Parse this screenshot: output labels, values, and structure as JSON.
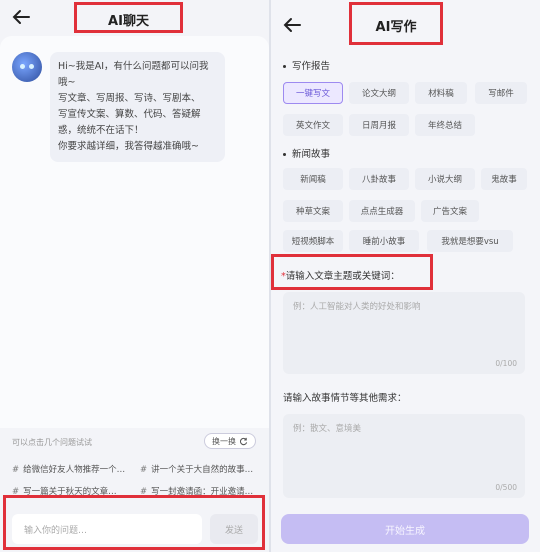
{
  "left": {
    "title": "AI聊天",
    "message_lines": [
      "Hi~我是AI，有什么问题都可以问我哦~",
      "写文章、写周报、写诗、写剧本、",
      "写宣传文案、算数、代码、答疑解",
      "惑，统统不在话下！",
      "你要求越详细，我答得越准确哦~"
    ],
    "hint": "可以点击几个问题试试",
    "swap_label": "换一换",
    "suggestions": [
      "给微信好友人物推荐一个…",
      "讲一个关于大自然的故事…",
      "写一篇关于秋天的文章…",
      "写一封邀请函：开业邀请…"
    ],
    "input_placeholder": "输入你的问题…",
    "send_label": "发送"
  },
  "right": {
    "title": "AI写作",
    "section1": "写作报告",
    "section1_chips": [
      "一键写文",
      "论文大纲",
      "材料稿",
      "写邮件",
      "英文作文",
      "日周月报",
      "年终总结"
    ],
    "section2": "新闻故事",
    "section2_chips": [
      "新闻稿",
      "八卦故事",
      "小说大纲",
      "鬼故事",
      "种草文案",
      "点点生成器",
      "广告文案",
      "短视频脚本",
      "睡前小故事",
      "我就是想要vsu"
    ],
    "field1_label": "请输入文章主题或关键词：",
    "field1_placeholder": "例：人工智能对人类的好处和影响",
    "field1_count": "0/100",
    "field2_label": "请输入故事情节等其他需求：",
    "field2_placeholder": "例：散文、意境美",
    "field2_count": "0/500",
    "generate_label": "开始生成"
  }
}
